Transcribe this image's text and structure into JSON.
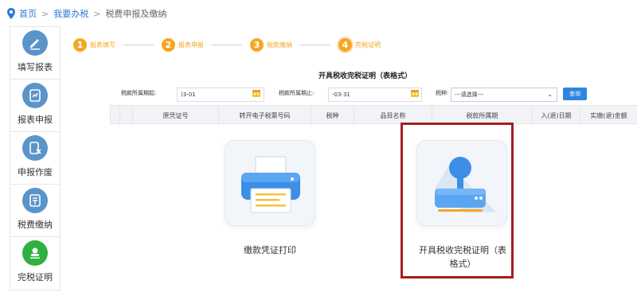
{
  "breadcrumb": {
    "home": "首页",
    "sep1": ">",
    "mytax": "我要办税",
    "sep2": ">",
    "current": "税费申报及缴纳"
  },
  "sidebar": {
    "items": [
      {
        "label": "填写报表",
        "icon": "edit-icon"
      },
      {
        "label": "报表申报",
        "icon": "report-upload-icon"
      },
      {
        "label": "申报作废",
        "icon": "cancel-report-icon"
      },
      {
        "label": "税费缴纳",
        "icon": "payment-icon"
      },
      {
        "label": "完税证明",
        "icon": "stamp-icon"
      }
    ],
    "colors": {
      "icon": "#5b94c9",
      "active": "#2fb13f"
    }
  },
  "steps": [
    {
      "num": "1",
      "label": "报表填写"
    },
    {
      "num": "2",
      "label": "报表申报"
    },
    {
      "num": "3",
      "label": "税款缴纳"
    },
    {
      "num": "4",
      "label": "完税证明"
    }
  ],
  "form": {
    "title": "开具税收完税证明（表格式）",
    "filter": {
      "start_label": "税款所属期起:",
      "start_value": ")3-01",
      "end_label": "税款所属期止:",
      "end_value": "-03-31",
      "type_label": "税种:",
      "type_value": "---请选择---",
      "query": "查询"
    },
    "columns": [
      "原凭证号",
      "转开电子税票号码",
      "税种",
      "品目名称",
      "税款所属期",
      "入(退)日期",
      "实缴(退)金额"
    ]
  },
  "cards": [
    {
      "label": "缴款凭证打印",
      "icon": "printer-icon"
    },
    {
      "label": "开具税收完税证明（表格式）",
      "label_line1": "开具税收完税证明（表",
      "label_line2": "格式）",
      "icon": "stamp-icon"
    }
  ],
  "colors": {
    "accent": "#f5a623",
    "link": "#2b7bd8",
    "button": "#2e86de",
    "highlight": "#a61e20"
  }
}
